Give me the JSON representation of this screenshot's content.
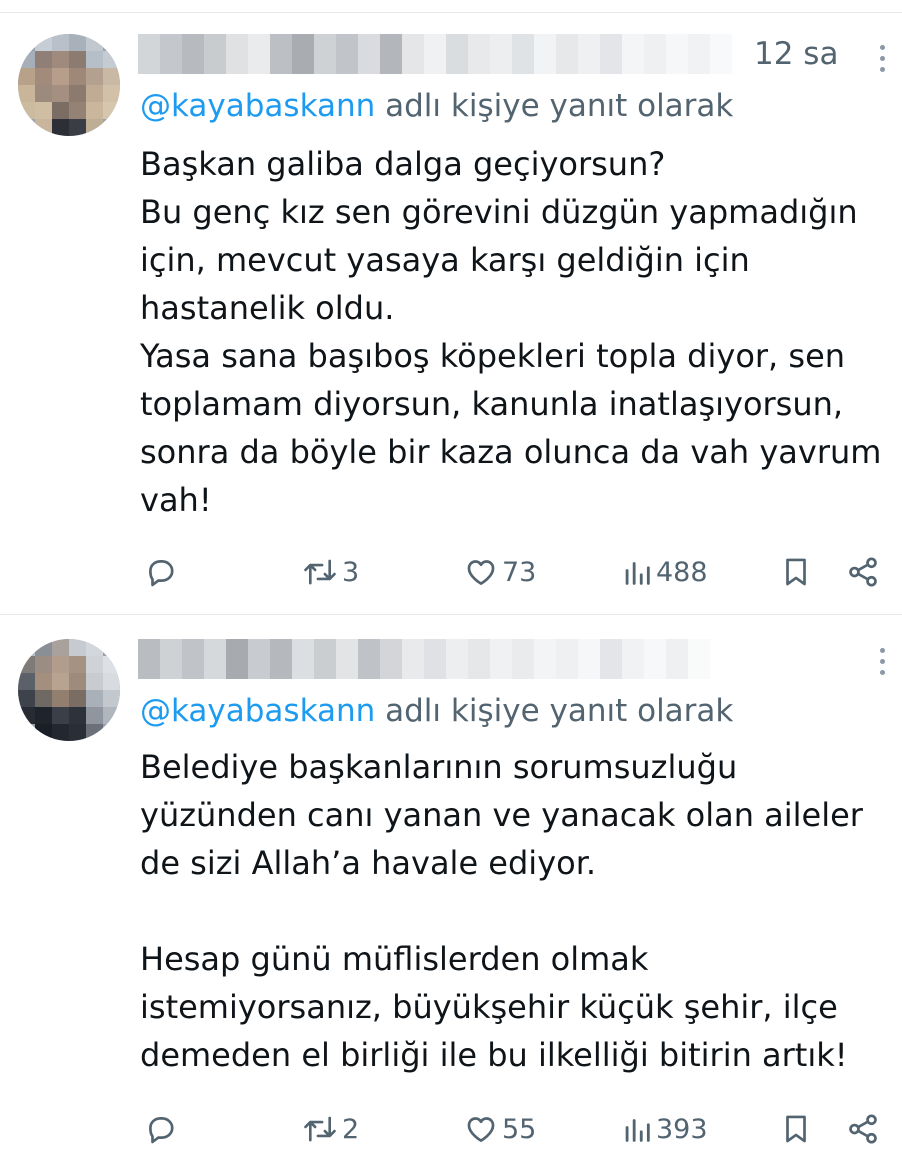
{
  "tweets": [
    {
      "time": "12 sa",
      "reply_handle": "@kayabaskann",
      "reply_suffix": " adlı kişiye yanıt olarak",
      "text": "Başkan galiba dalga geçiyorsun?\nBu genç kız sen görevini düzgün yapmadığın için, mevcut yasaya karşı geldiğin için hastanelik oldu.\nYasa sana başıboş köpekleri topla diyor, sen toplamam diyorsun, kanunla inatlaşıyorsun, sonra da böyle bir kaza olunca da vah yavrum vah!",
      "retweets": "3",
      "likes": "73",
      "views": "488"
    },
    {
      "time": "",
      "reply_handle": "@kayabaskann",
      "reply_suffix": " adlı kişiye yanıt olarak",
      "text": "Belediye başkanlarının sorumsuzluğu yüzünden canı yanan ve yanacak olan aileler de sizi Allah’a havale ediyor.\n\nHesap günü müflislerden olmak istemiyorsanız, büyükşehir küçük şehir, ilçe demeden el birliği ile bu ilkelliği bitirin artık!",
      "retweets": "2",
      "likes": "55",
      "views": "393"
    }
  ],
  "icons": {
    "reply": "reply-icon",
    "retweet": "retweet-icon",
    "like": "heart-icon",
    "views": "views-icon",
    "bookmark": "bookmark-icon",
    "share": "share-icon",
    "more": "more-icon"
  },
  "colors": {
    "text": "#0f1419",
    "secondary": "#536471",
    "link": "#1d9bf0",
    "divider": "#e6e9ec"
  }
}
